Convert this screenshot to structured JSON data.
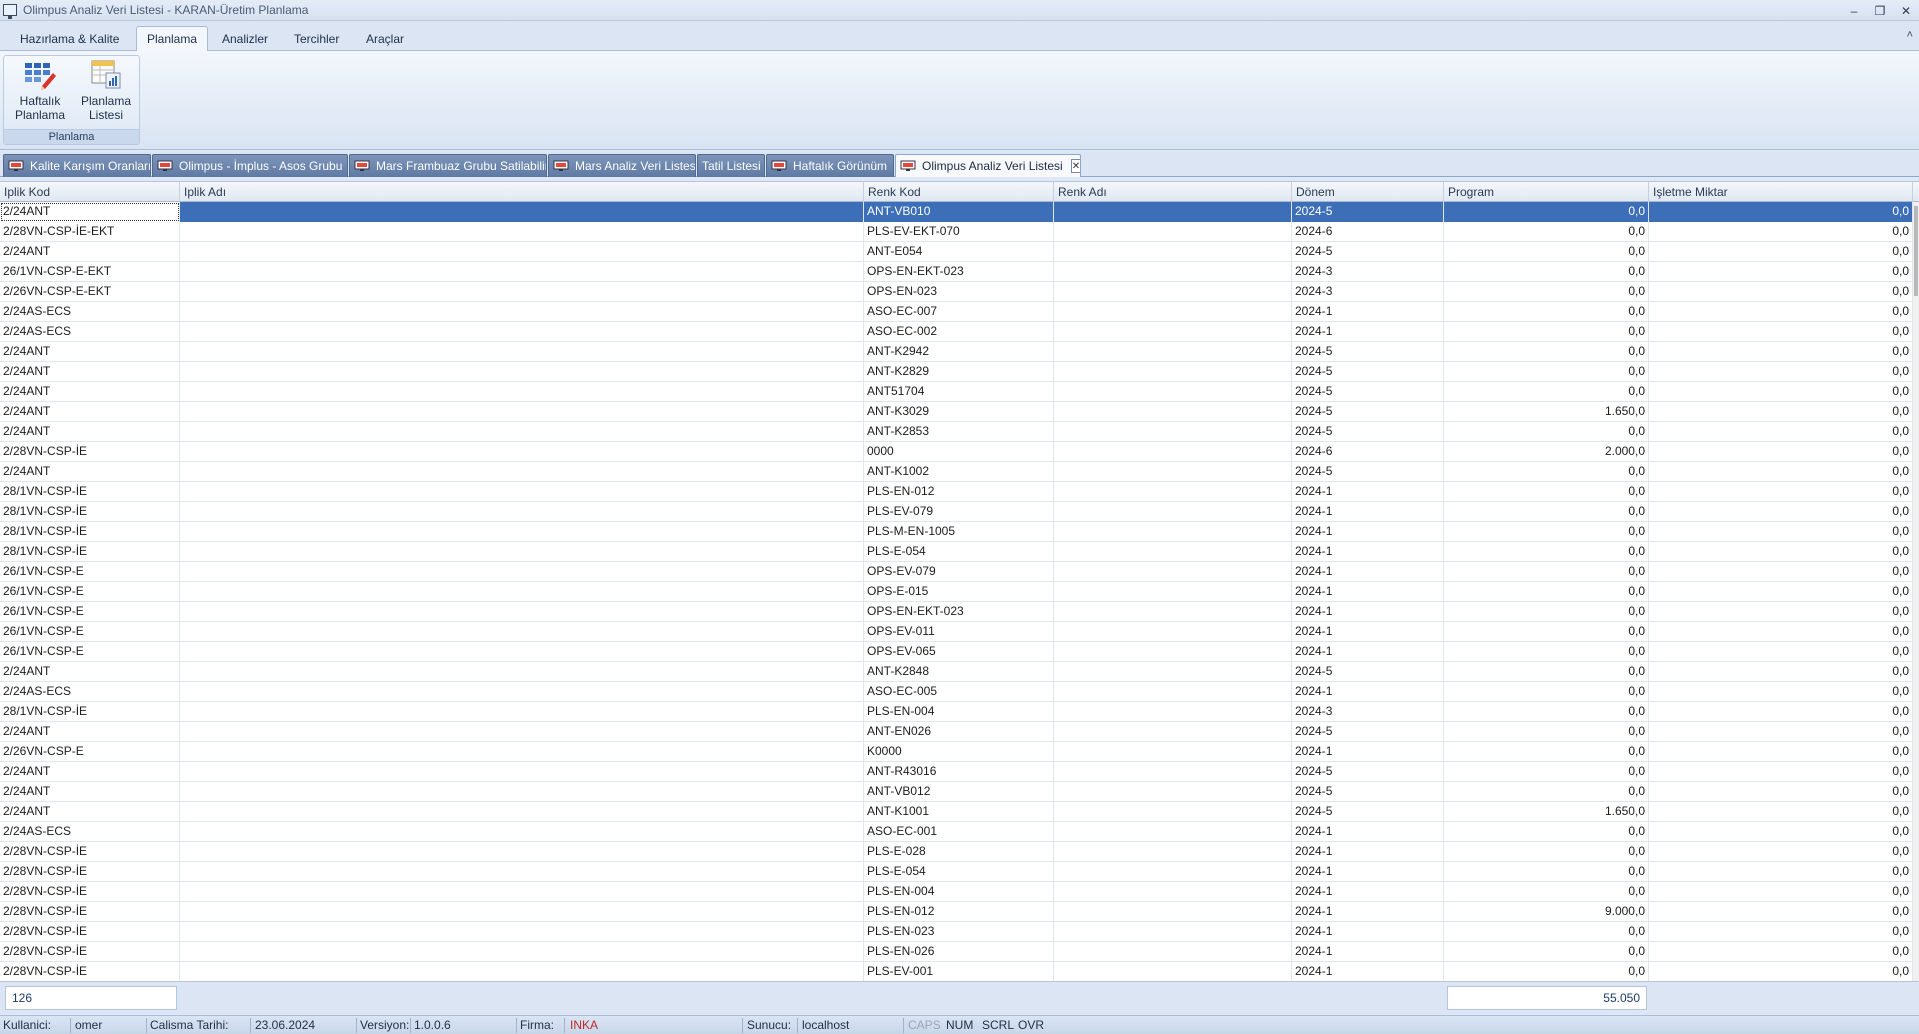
{
  "window": {
    "title": "Olimpus Analiz Veri Listesi - KARAN-Üretim Planlama",
    "controls": [
      "–",
      "❐",
      "✕"
    ]
  },
  "ribbon": {
    "tabs": [
      "Hazırlama & Kalite",
      "Planlama",
      "Analizler",
      "Tercihler",
      "Araçlar"
    ],
    "active_tab": "Planlama",
    "group_label": "Planlama",
    "buttons": [
      {
        "label_line1": "Haftalık",
        "label_line2": "Planlama",
        "icon": "weekly-planning-icon"
      },
      {
        "label_line1": "Planlama",
        "label_line2": "Listesi",
        "icon": "planning-list-icon"
      }
    ],
    "collapse_icon": "˄"
  },
  "doc_tabs": [
    "Kalite Karışım Oranları",
    "Olimpus - İmplus - Asos Grubu",
    "Mars Frambuaz Grubu Satilabilir",
    "Mars Analiz Veri Listesi",
    "Tatil Listesi",
    "Haftalık Görünüm",
    "Olimpus Analiz Veri Listesi"
  ],
  "active_doc_tab": "Olimpus Analiz Veri Listesi",
  "grid": {
    "columns": [
      "Iplik Kod",
      "Iplik Adı",
      "Renk Kod",
      "Renk Adı",
      "Dönem",
      "Program",
      "Işletme Miktar"
    ],
    "rows": [
      [
        "2/24ANT",
        "",
        "ANT-VB010",
        "",
        "2024-5",
        "0,0",
        "0,0"
      ],
      [
        "2/28VN-CSP-İE-EKT",
        "",
        "PLS-EV-EKT-070",
        "",
        "2024-6",
        "0,0",
        "0,0"
      ],
      [
        "2/24ANT",
        "",
        "ANT-E054",
        "",
        "2024-5",
        "0,0",
        "0,0"
      ],
      [
        "26/1VN-CSP-E-EKT",
        "",
        "OPS-EN-EKT-023",
        "",
        "2024-3",
        "0,0",
        "0,0"
      ],
      [
        "2/26VN-CSP-E-EKT",
        "",
        "OPS-EN-023",
        "",
        "2024-3",
        "0,0",
        "0,0"
      ],
      [
        "2/24AS-ECS",
        "",
        "ASO-EC-007",
        "",
        "2024-1",
        "0,0",
        "0,0"
      ],
      [
        "2/24AS-ECS",
        "",
        "ASO-EC-002",
        "",
        "2024-1",
        "0,0",
        "0,0"
      ],
      [
        "2/24ANT",
        "",
        "ANT-K2942",
        "",
        "2024-5",
        "0,0",
        "0,0"
      ],
      [
        "2/24ANT",
        "",
        "ANT-K2829",
        "",
        "2024-5",
        "0,0",
        "0,0"
      ],
      [
        "2/24ANT",
        "",
        "ANT51704",
        "",
        "2024-5",
        "0,0",
        "0,0"
      ],
      [
        "2/24ANT",
        "",
        "ANT-K3029",
        "",
        "2024-5",
        "1.650,0",
        "0,0"
      ],
      [
        "2/24ANT",
        "",
        "ANT-K2853",
        "",
        "2024-5",
        "0,0",
        "0,0"
      ],
      [
        "2/28VN-CSP-İE",
        "",
        "0000",
        "",
        "2024-6",
        "2.000,0",
        "0,0"
      ],
      [
        "2/24ANT",
        "",
        "ANT-K1002",
        "",
        "2024-5",
        "0,0",
        "0,0"
      ],
      [
        "28/1VN-CSP-İE",
        "",
        "PLS-EN-012",
        "",
        "2024-1",
        "0,0",
        "0,0"
      ],
      [
        "28/1VN-CSP-İE",
        "",
        "PLS-EV-079",
        "",
        "2024-1",
        "0,0",
        "0,0"
      ],
      [
        "28/1VN-CSP-İE",
        "",
        "PLS-M-EN-1005",
        "",
        "2024-1",
        "0,0",
        "0,0"
      ],
      [
        "28/1VN-CSP-İE",
        "",
        "PLS-E-054",
        "",
        "2024-1",
        "0,0",
        "0,0"
      ],
      [
        "26/1VN-CSP-E",
        "",
        "OPS-EV-079",
        "",
        "2024-1",
        "0,0",
        "0,0"
      ],
      [
        "26/1VN-CSP-E",
        "",
        "OPS-E-015",
        "",
        "2024-1",
        "0,0",
        "0,0"
      ],
      [
        "26/1VN-CSP-E",
        "",
        "OPS-EN-EKT-023",
        "",
        "2024-1",
        "0,0",
        "0,0"
      ],
      [
        "26/1VN-CSP-E",
        "",
        "OPS-EV-011",
        "",
        "2024-1",
        "0,0",
        "0,0"
      ],
      [
        "26/1VN-CSP-E",
        "",
        "OPS-EV-065",
        "",
        "2024-1",
        "0,0",
        "0,0"
      ],
      [
        "2/24ANT",
        "",
        "ANT-K2848",
        "",
        "2024-5",
        "0,0",
        "0,0"
      ],
      [
        "2/24AS-ECS",
        "",
        "ASO-EC-005",
        "",
        "2024-1",
        "0,0",
        "0,0"
      ],
      [
        "28/1VN-CSP-İE",
        "",
        "PLS-EN-004",
        "",
        "2024-3",
        "0,0",
        "0,0"
      ],
      [
        "2/24ANT",
        "",
        "ANT-EN026",
        "",
        "2024-5",
        "0,0",
        "0,0"
      ],
      [
        "2/26VN-CSP-E",
        "",
        "K0000",
        "",
        "2024-1",
        "0,0",
        "0,0"
      ],
      [
        "2/24ANT",
        "",
        "ANT-R43016",
        "",
        "2024-5",
        "0,0",
        "0,0"
      ],
      [
        "2/24ANT",
        "",
        "ANT-VB012",
        "",
        "2024-5",
        "0,0",
        "0,0"
      ],
      [
        "2/24ANT",
        "",
        "ANT-K1001",
        "",
        "2024-5",
        "1.650,0",
        "0,0"
      ],
      [
        "2/24AS-ECS",
        "",
        "ASO-EC-001",
        "",
        "2024-1",
        "0,0",
        "0,0"
      ],
      [
        "2/28VN-CSP-İE",
        "",
        "PLS-E-028",
        "",
        "2024-1",
        "0,0",
        "0,0"
      ],
      [
        "2/28VN-CSP-İE",
        "",
        "PLS-E-054",
        "",
        "2024-1",
        "0,0",
        "0,0"
      ],
      [
        "2/28VN-CSP-İE",
        "",
        "PLS-EN-004",
        "",
        "2024-1",
        "0,0",
        "0,0"
      ],
      [
        "2/28VN-CSP-İE",
        "",
        "PLS-EN-012",
        "",
        "2024-1",
        "9.000,0",
        "0,0"
      ],
      [
        "2/28VN-CSP-İE",
        "",
        "PLS-EN-023",
        "",
        "2024-1",
        "0,0",
        "0,0"
      ],
      [
        "2/28VN-CSP-İE",
        "",
        "PLS-EN-026",
        "",
        "2024-1",
        "0,0",
        "0,0"
      ],
      [
        "2/28VN-CSP-İE",
        "",
        "PLS-EV-001",
        "",
        "2024-1",
        "0,0",
        "0,0"
      ]
    ],
    "selected_row": 0
  },
  "footer": {
    "row_count": "126",
    "program_total": "55.050"
  },
  "statusbar": {
    "user_label": "Kullanici:",
    "user_value": "omer",
    "date_label": "Calisma Tarihi:",
    "date_value": "23.06.2024",
    "version_label": "Versiyon:",
    "version_value": "1.0.0.6",
    "firm_label": "Firma:",
    "firm_value": "INKA",
    "server_label": "Sunucu:",
    "server_value": "localhost",
    "caps": "CAPS",
    "num": "NUM",
    "scrl": "SCRL",
    "ovr": "OVR"
  }
}
